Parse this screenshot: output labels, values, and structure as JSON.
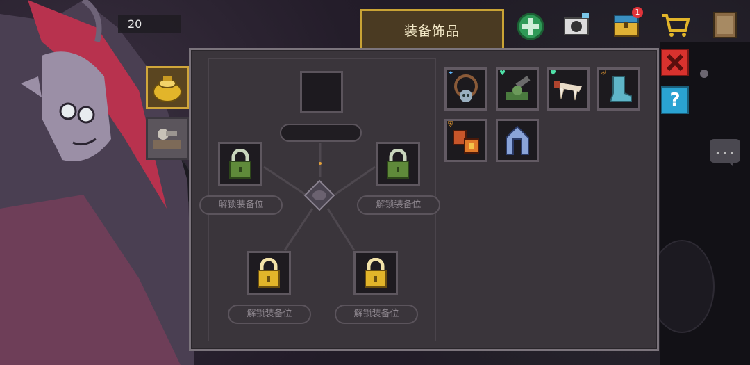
{
  "hud": {
    "coin_count": "20",
    "title_tab": "装备饰品",
    "notification_count": "1"
  },
  "side_tabs": [
    {
      "icon": "gold-pot-icon",
      "active": true
    },
    {
      "icon": "mouse-trap-icon",
      "active": false
    }
  ],
  "accessory_slots": [
    {
      "position": "left",
      "locked": true,
      "lock_color": "green",
      "label": "解锁装备位"
    },
    {
      "position": "right",
      "locked": true,
      "lock_color": "green",
      "label": "解锁装备位"
    },
    {
      "position": "bottom-left",
      "locked": true,
      "lock_color": "gold",
      "label": "解锁装备位"
    },
    {
      "position": "bottom-right",
      "locked": true,
      "lock_color": "gold",
      "label": "解锁装备位"
    }
  ],
  "inventory": [
    {
      "icon": "skull-necklace-icon",
      "marker": "blue-star"
    },
    {
      "icon": "green-cannon-icon",
      "marker": "green-heart"
    },
    {
      "icon": "bone-fangs-icon",
      "marker": "green-heart"
    },
    {
      "icon": "teal-boot-icon",
      "marker": "orange-shield"
    },
    {
      "icon": "fire-gauntlet-icon",
      "marker": "orange-shield"
    },
    {
      "icon": "blue-hood-icon",
      "marker": ""
    }
  ],
  "colors": {
    "panel": "#3a353b",
    "accent_gold": "#c9a335",
    "close_red": "#d8322e",
    "help_blue": "#2aa3d2",
    "lock_green": "#5f8a3a",
    "lock_gold": "#e2b52a"
  }
}
